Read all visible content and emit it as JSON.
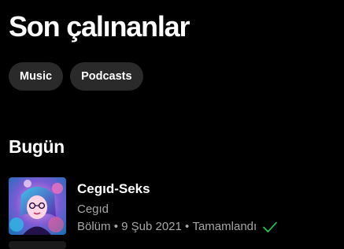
{
  "page": {
    "title": "Son çalınanlar"
  },
  "filters": [
    {
      "label": "Music"
    },
    {
      "label": "Podcasts"
    }
  ],
  "sections": [
    {
      "title": "Bugün",
      "items": [
        {
          "title": "Cegıd-Seks",
          "show": "Cegıd",
          "type": "Bölüm",
          "date": "9 Şub 2021",
          "status": "Tamamlandı",
          "status_icon": "check-icon",
          "cover_icon": "podcast-cover-image"
        }
      ]
    }
  ],
  "colors": {
    "background": "#000000",
    "chip_background": "#2a2a2a",
    "secondary_text": "#a7a7a7",
    "accent_green": "#1ed760"
  }
}
